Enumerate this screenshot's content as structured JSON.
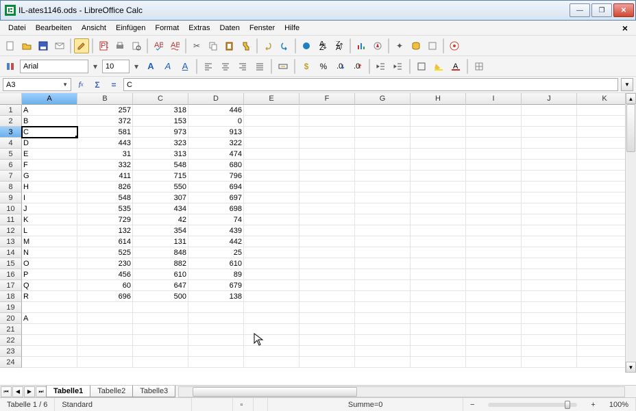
{
  "window": {
    "title": "IL-ates1146.ods - LibreOffice Calc"
  },
  "menu": [
    "Datei",
    "Bearbeiten",
    "Ansicht",
    "Einfügen",
    "Format",
    "Extras",
    "Daten",
    "Fenster",
    "Hilfe"
  ],
  "format": {
    "font": "Arial",
    "size": "10"
  },
  "cellref": {
    "name": "A3",
    "formula": "C"
  },
  "columns": [
    "A",
    "B",
    "C",
    "D",
    "E",
    "F",
    "G",
    "H",
    "I",
    "J",
    "K"
  ],
  "active_col_index": 0,
  "active_row": 3,
  "rows": [
    {
      "n": 1,
      "A": "A",
      "B": "257",
      "C": "318",
      "D": "446"
    },
    {
      "n": 2,
      "A": "B",
      "B": "372",
      "C": "153",
      "D": "0"
    },
    {
      "n": 3,
      "A": "C",
      "B": "581",
      "C": "973",
      "D": "913"
    },
    {
      "n": 4,
      "A": "D",
      "B": "443",
      "C": "323",
      "D": "322"
    },
    {
      "n": 5,
      "A": "E",
      "B": "31",
      "C": "313",
      "D": "474"
    },
    {
      "n": 6,
      "A": "F",
      "B": "332",
      "C": "548",
      "D": "680"
    },
    {
      "n": 7,
      "A": "G",
      "B": "411",
      "C": "715",
      "D": "796"
    },
    {
      "n": 8,
      "A": "H",
      "B": "826",
      "C": "550",
      "D": "694"
    },
    {
      "n": 9,
      "A": "I",
      "B": "548",
      "C": "307",
      "D": "697"
    },
    {
      "n": 10,
      "A": "J",
      "B": "535",
      "C": "434",
      "D": "698"
    },
    {
      "n": 11,
      "A": "K",
      "B": "729",
      "C": "42",
      "D": "74"
    },
    {
      "n": 12,
      "A": "L",
      "B": "132",
      "C": "354",
      "D": "439"
    },
    {
      "n": 13,
      "A": "M",
      "B": "614",
      "C": "131",
      "D": "442"
    },
    {
      "n": 14,
      "A": "N",
      "B": "525",
      "C": "848",
      "D": "25"
    },
    {
      "n": 15,
      "A": "O",
      "B": "230",
      "C": "882",
      "D": "610"
    },
    {
      "n": 16,
      "A": "P",
      "B": "456",
      "C": "610",
      "D": "89"
    },
    {
      "n": 17,
      "A": "Q",
      "B": "60",
      "C": "647",
      "D": "679"
    },
    {
      "n": 18,
      "A": "R",
      "B": "696",
      "C": "500",
      "D": "138"
    },
    {
      "n": 19,
      "A": "",
      "B": "",
      "C": "",
      "D": ""
    },
    {
      "n": 20,
      "A": "A",
      "B": "",
      "C": "",
      "D": ""
    },
    {
      "n": 21,
      "A": "",
      "B": "",
      "C": "",
      "D": ""
    },
    {
      "n": 22,
      "A": "",
      "B": "",
      "C": "",
      "D": ""
    },
    {
      "n": 23,
      "A": "",
      "B": "",
      "C": "",
      "D": ""
    },
    {
      "n": 24,
      "A": "",
      "B": "",
      "C": "",
      "D": ""
    }
  ],
  "sheets": [
    "Tabelle1",
    "Tabelle2",
    "Tabelle3"
  ],
  "active_sheet": 0,
  "status": {
    "sheet": "Tabelle 1 / 6",
    "style": "Standard",
    "sum": "Summe=0",
    "zoom": "100%"
  }
}
